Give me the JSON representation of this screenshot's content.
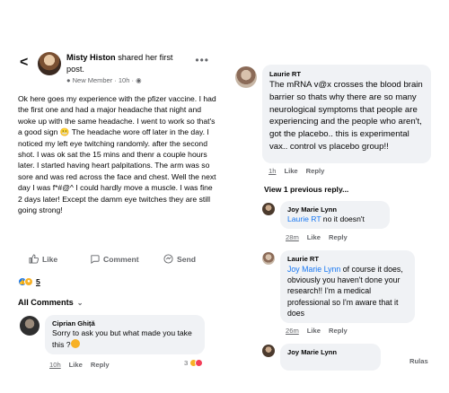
{
  "post": {
    "author": "Misty Histon",
    "action": "shared her first post.",
    "badge": "New Member",
    "time": "10h",
    "body": [
      "Ok here goes my experience with the pfizer vaccine. I had the first one and had a major headache that night and woke up with the same headache. I went to work so that's a good sign",
      "The headache wore off later in the day. I noticed my left eye twitching randomly. after the second shot. I was ok sat the 15 mins and thenr a couple hours later.  I started having heart palpitations. The arm was so sore and was red across the face and chest. Well the next day I was f*#@^ I could hardly move a muscle. I was fine 2 days later! Except the damm eye twitches they are still going strong!"
    ],
    "actions": {
      "like": "Like",
      "comment": "Comment",
      "send": "Send"
    },
    "reaction_count": "5",
    "all_comments_label": "All Comments"
  },
  "comment_ciprian": {
    "name": "Ciprian Ghiță",
    "text": "Sorry to ask you but what made you take this ?",
    "time": "10h",
    "like": "Like",
    "reply": "Reply",
    "reaction_count": "3"
  },
  "thread": {
    "laurie_1": {
      "name": "Laurie RT",
      "text": "The mRNA v@x crosses the blood brain barrier so thats why there are so many neurological symptoms that people are experiencing and the people who aren't, got the placebo.. this is experimental vax.. control vs placebo group!!",
      "time": "1h",
      "like": "Like",
      "reply": "Reply"
    },
    "view_previous": "View 1 previous reply...",
    "joy_1": {
      "name": "Joy Marie Lynn",
      "mention": "Laurie RT",
      "text": " no it doesn't",
      "time": "28m",
      "like": "Like",
      "reply": "Reply"
    },
    "laurie_2": {
      "name": "Laurie RT",
      "mention": "Joy Marie Lynn",
      "text": " of course it does, obviously you haven't done your research!! I'm a medical professional so I'm aware that it does",
      "time": "26m",
      "like": "Like",
      "reply": "Reply"
    },
    "joy_2": {
      "name": "Joy Marie Lynn"
    },
    "reply_cut": "Rulas"
  },
  "colors": {
    "link_blue": "#1877f2",
    "bubble_bg": "#f0f2f5",
    "meta_gray": "#65676b"
  },
  "icons": [
    "back-icon",
    "more-icon",
    "globe-icon",
    "like-icon",
    "comment-icon",
    "send-icon",
    "chevron-down-icon"
  ]
}
